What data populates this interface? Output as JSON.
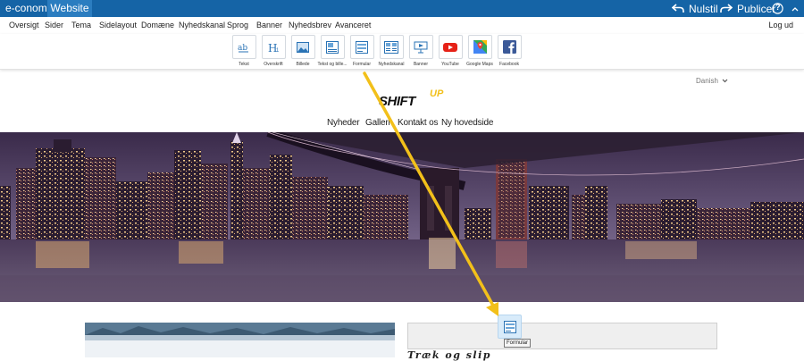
{
  "topbar": {
    "brand": "e-conomic",
    "active_tab": "Website",
    "reset_label": "Nulstil",
    "publish_label": "Publicer",
    "help_label": "?"
  },
  "menu": {
    "items": [
      "Oversigt",
      "Sider",
      "Tema",
      "Sidelayout",
      "Domæne",
      "Nyhedskanal",
      "Sprog",
      "Banner",
      "Nyhedsbrev",
      "Avanceret"
    ],
    "logout": "Log ud"
  },
  "tools": [
    {
      "label": "Tekst",
      "icon": "text-icon"
    },
    {
      "label": "Overskrift",
      "icon": "heading-icon"
    },
    {
      "label": "Billede",
      "icon": "image-icon"
    },
    {
      "label": "Tekst og bille...",
      "icon": "text-image-icon"
    },
    {
      "label": "Formular",
      "icon": "form-icon"
    },
    {
      "label": "Nyhedskanal",
      "icon": "news-icon"
    },
    {
      "label": "Banner",
      "icon": "banner-icon"
    },
    {
      "label": "YouTube",
      "icon": "youtube-icon"
    },
    {
      "label": "Google Maps",
      "icon": "google-maps-icon"
    },
    {
      "label": "Facebook",
      "icon": "facebook-icon"
    }
  ],
  "site": {
    "language": "Danish",
    "logo_main": "SHIFT",
    "logo_accent": "UP",
    "nav": [
      "Nyheder",
      "Galleri",
      "Kontakt os",
      "Ny hovedside"
    ]
  },
  "drag": {
    "tooltip": "Formular",
    "heading": "Træk og slip"
  },
  "colors": {
    "topbar": "#1564a6",
    "accent": "#f2c01a"
  }
}
